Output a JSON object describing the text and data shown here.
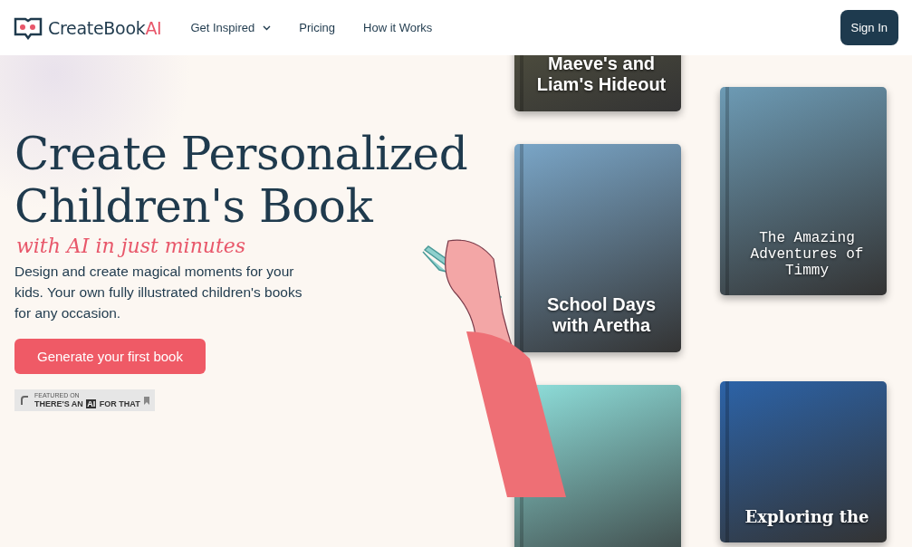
{
  "nav": {
    "logo": {
      "brand": "CreateBook",
      "accent": "AI"
    },
    "links": [
      {
        "label": "Get Inspired",
        "kind": "dropdown"
      },
      {
        "label": "Pricing",
        "kind": "link"
      },
      {
        "label": "How it Works",
        "kind": "link"
      }
    ],
    "sign_in": "Sign In"
  },
  "hero": {
    "title": "Create Personalized Children's Book",
    "tagline": "with AI in just minutes",
    "description": "Design and create magical moments for your kids. Your own  fully illustrated children's books for any occasion.",
    "cta": "Generate your first book",
    "badge": {
      "small": "FEATURED ON",
      "big_start": "THERE'S AN",
      "big_mark": "AI",
      "big_end": "FOR THAT"
    }
  },
  "books": [
    {
      "title": "Maeve's and Liam's Hideout"
    },
    {
      "title": "School Days with Aretha"
    },
    {
      "title": "The Amazing Adventures of Timmy"
    },
    {
      "title": "Exploring the"
    }
  ]
}
